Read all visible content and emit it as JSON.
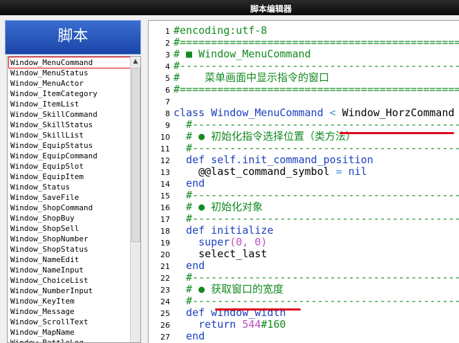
{
  "window": {
    "title": "脚本编辑器"
  },
  "sidebar": {
    "header": "脚本",
    "items": [
      "Window_MenuCommand",
      "Window_MenuStatus",
      "Window_MenuActor",
      "Window_ItemCategory",
      "Window_ItemList",
      "Window_SkillCommand",
      "Window_SkillStatus",
      "Window_SkillList",
      "Window_EquipStatus",
      "Window_EquipCommand",
      "Window_EquipSlot",
      "Window_EquipItem",
      "Window_Status",
      "Window_SaveFile",
      "Window_ShopCommand",
      "Window_ShopBuy",
      "Window_ShopSell",
      "Window_ShopNumber",
      "Window_ShopStatus",
      "Window_NameEdit",
      "Window_NameInput",
      "Window_ChoiceList",
      "Window_NumberInput",
      "Window_KeyItem",
      "Window_Message",
      "Window_ScrollText",
      "Window_MapName",
      "Window_BattleLog"
    ],
    "selected_index": 0
  },
  "editor": {
    "line_numbers": [
      "1",
      "2",
      "3",
      "4",
      "5",
      "6",
      "7",
      "8",
      "9",
      "10",
      "11",
      "12",
      "13",
      "14",
      "15",
      "16",
      "17",
      "18",
      "19",
      "20",
      "21",
      "22",
      "23",
      "24",
      "25",
      "26",
      "27"
    ],
    "lines": [
      {
        "parts": [
          {
            "c": "cm",
            "t": "#encoding:utf-8"
          }
        ]
      },
      {
        "parts": [
          {
            "c": "cm",
            "t": "#==============================================================================="
          }
        ]
      },
      {
        "parts": [
          {
            "c": "cm",
            "t": "# ■ Window_MenuCommand"
          }
        ]
      },
      {
        "parts": [
          {
            "c": "cm",
            "t": "#------------------------------------------------------------------------------"
          }
        ]
      },
      {
        "parts": [
          {
            "c": "cm",
            "t": "#    菜单画面中显示指令的窗口"
          }
        ]
      },
      {
        "parts": [
          {
            "c": "cm",
            "t": "#==============================================================================="
          }
        ]
      },
      {
        "parts": []
      },
      {
        "parts": [
          {
            "c": "kw",
            "t": "class Window_MenuCommand "
          },
          {
            "c": "sym",
            "t": "<"
          },
          {
            "c": "plain",
            "t": " Window_HorzCommand"
          }
        ]
      },
      {
        "parts": [
          {
            "c": "cm",
            "t": "  #--------------------------------------------------------------------------"
          }
        ]
      },
      {
        "parts": [
          {
            "c": "cm",
            "t": "  # ● 初始化指令选择位置（类方法）"
          }
        ]
      },
      {
        "parts": [
          {
            "c": "cm",
            "t": "  #--------------------------------------------------------------------------"
          }
        ]
      },
      {
        "parts": [
          {
            "c": "kw",
            "t": "  def self.init_command_position"
          }
        ]
      },
      {
        "parts": [
          {
            "c": "plain",
            "t": "    @@last_command_symbol "
          },
          {
            "c": "sym",
            "t": "="
          },
          {
            "c": "kw",
            "t": " nil"
          }
        ]
      },
      {
        "parts": [
          {
            "c": "kw",
            "t": "  end"
          }
        ]
      },
      {
        "parts": [
          {
            "c": "cm",
            "t": "  #--------------------------------------------------------------------------"
          }
        ]
      },
      {
        "parts": [
          {
            "c": "cm",
            "t": "  # ● 初始化对象"
          }
        ]
      },
      {
        "parts": [
          {
            "c": "cm",
            "t": "  #--------------------------------------------------------------------------"
          }
        ]
      },
      {
        "parts": [
          {
            "c": "kw",
            "t": "  def initialize"
          }
        ]
      },
      {
        "parts": [
          {
            "c": "kw",
            "t": "    super"
          },
          {
            "c": "num",
            "t": "(0, 0)"
          }
        ]
      },
      {
        "parts": [
          {
            "c": "plain",
            "t": "    select_last"
          }
        ]
      },
      {
        "parts": [
          {
            "c": "kw",
            "t": "  end"
          }
        ]
      },
      {
        "parts": [
          {
            "c": "cm",
            "t": "  #--------------------------------------------------------------------------"
          }
        ]
      },
      {
        "parts": [
          {
            "c": "cm",
            "t": "  # ● 获取窗口的宽度"
          }
        ]
      },
      {
        "parts": [
          {
            "c": "cm",
            "t": "  #--------------------------------------------------------------------------"
          }
        ]
      },
      {
        "parts": [
          {
            "c": "kw",
            "t": "  def window_width"
          }
        ]
      },
      {
        "parts": [
          {
            "c": "kw",
            "t": "    return "
          },
          {
            "c": "num",
            "t": "544"
          },
          {
            "c": "cm",
            "t": "#160"
          }
        ]
      },
      {
        "parts": [
          {
            "c": "kw",
            "t": "  end"
          }
        ]
      }
    ]
  }
}
